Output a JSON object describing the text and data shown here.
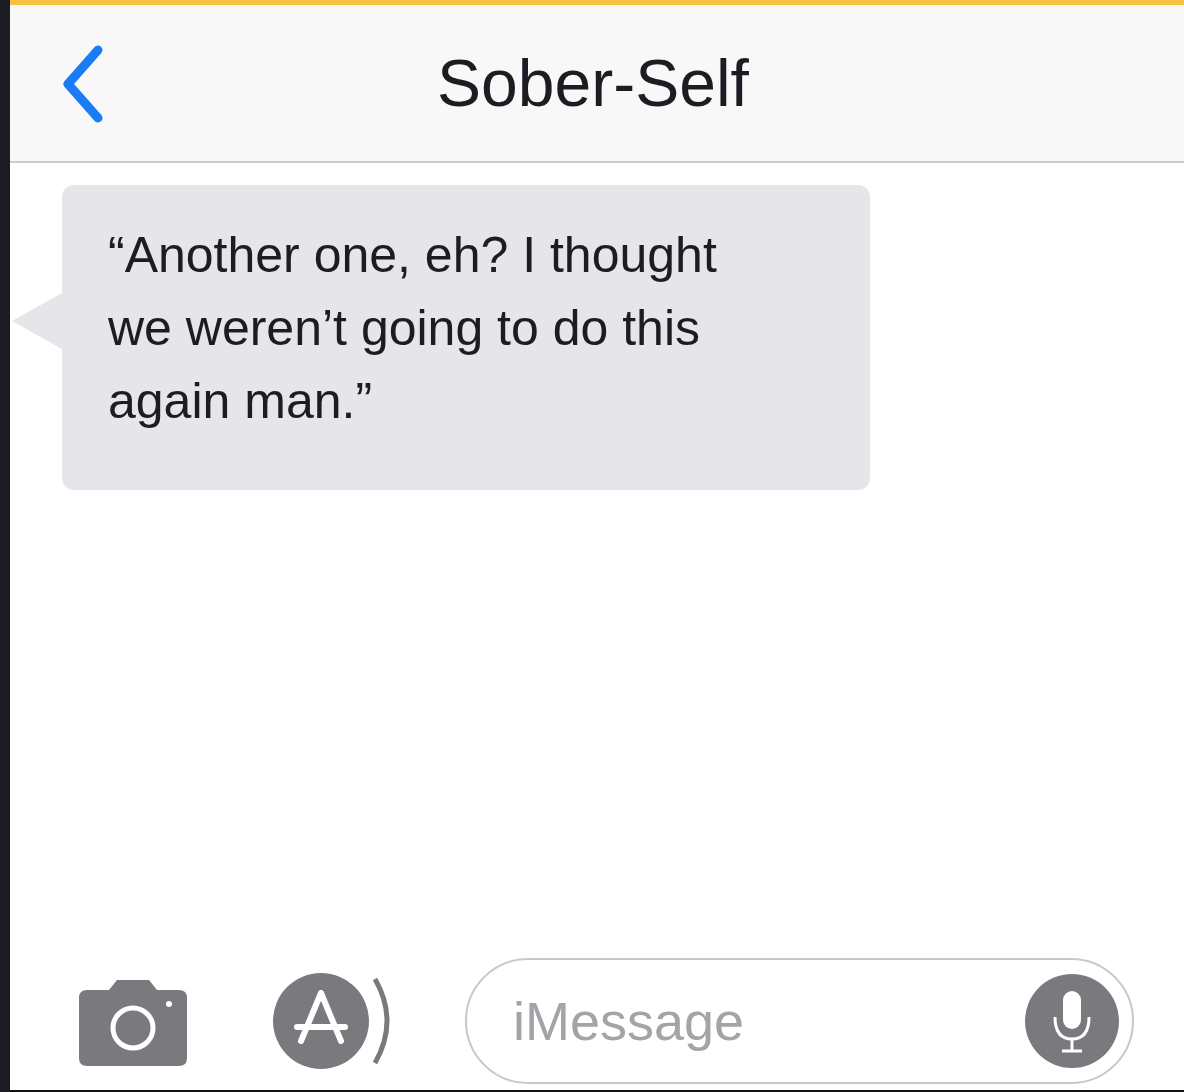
{
  "header": {
    "title": "Sober-Self"
  },
  "messages": [
    {
      "kind": "received",
      "text": "“Another one, eh? I thought we weren’t going to do this again man.”"
    }
  ],
  "composer": {
    "placeholder": "iMessage"
  }
}
